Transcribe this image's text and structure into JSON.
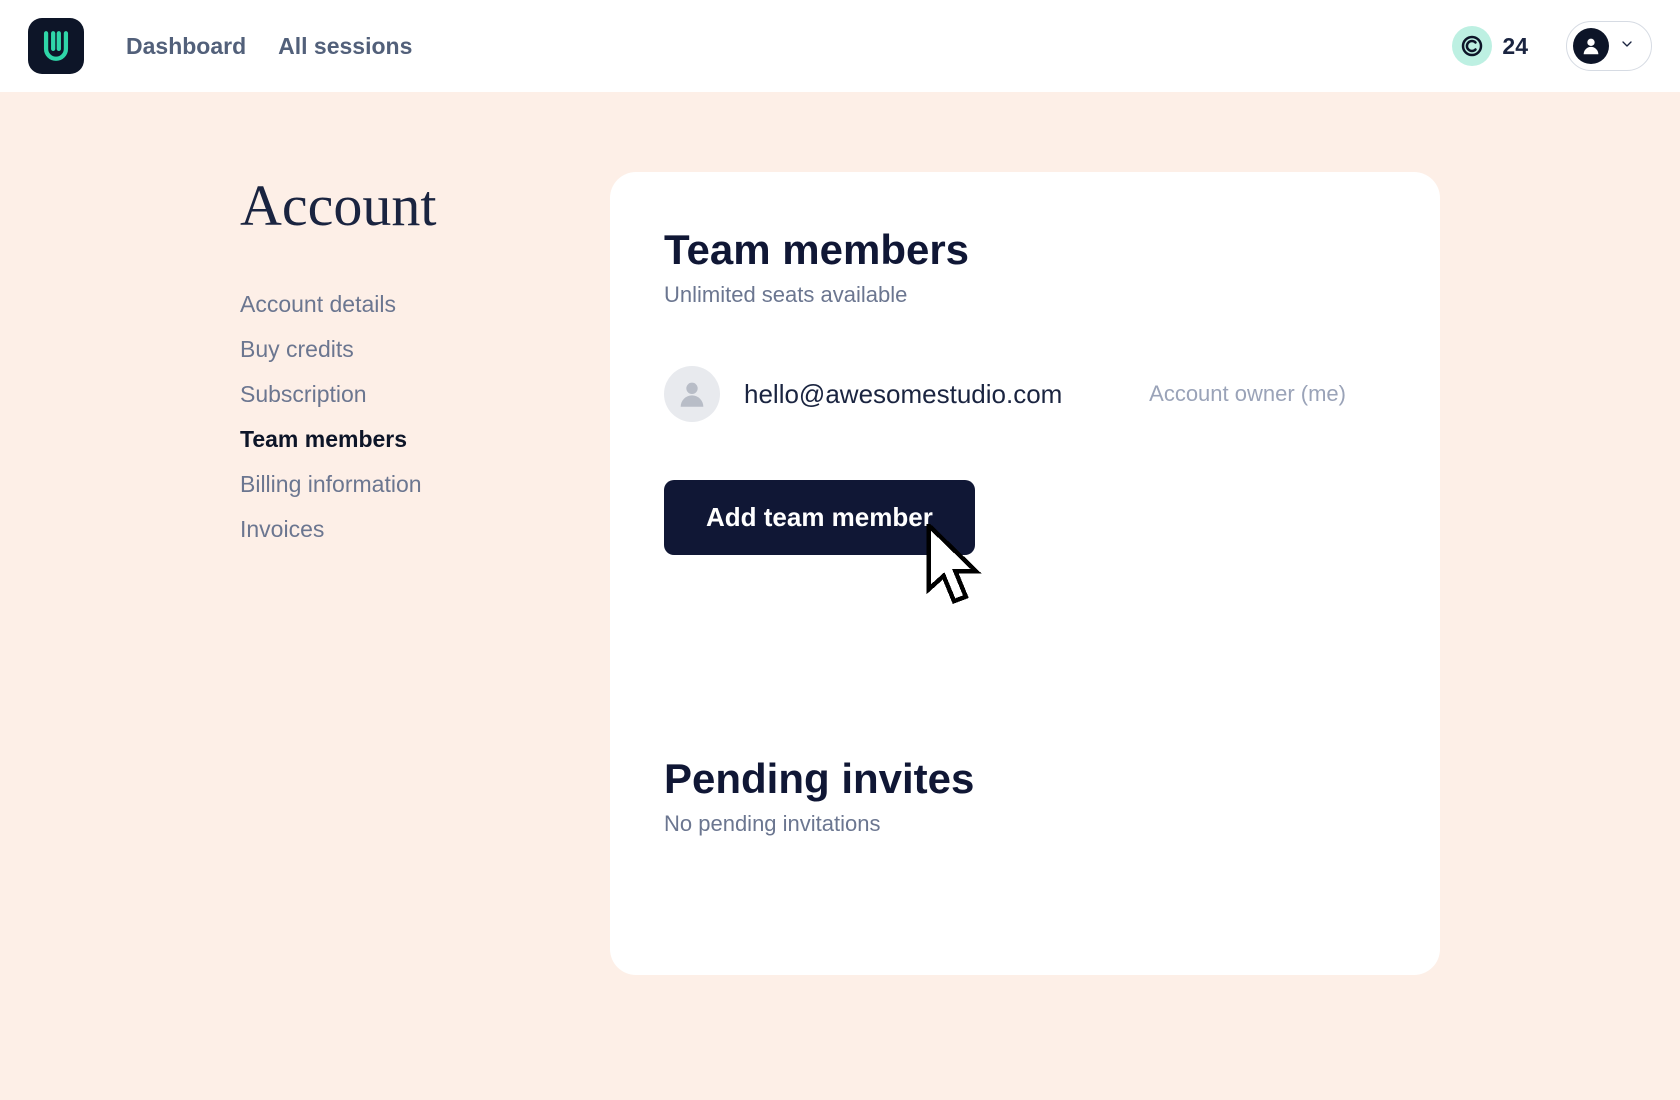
{
  "nav": {
    "links": [
      "Dashboard",
      "All sessions"
    ],
    "credits": "24"
  },
  "page": {
    "title": "Account"
  },
  "sidebar": {
    "items": [
      {
        "label": "Account details",
        "active": false
      },
      {
        "label": "Buy credits",
        "active": false
      },
      {
        "label": "Subscription",
        "active": false
      },
      {
        "label": "Team members",
        "active": true
      },
      {
        "label": "Billing information",
        "active": false
      },
      {
        "label": "Invoices",
        "active": false
      }
    ]
  },
  "team": {
    "title": "Team members",
    "subtitle": "Unlimited seats available",
    "members": [
      {
        "email": "hello@awesomestudio.com",
        "role": "Account owner (me)"
      }
    ],
    "add_button": "Add team member"
  },
  "pending": {
    "title": "Pending invites",
    "subtitle": "No pending invitations"
  }
}
